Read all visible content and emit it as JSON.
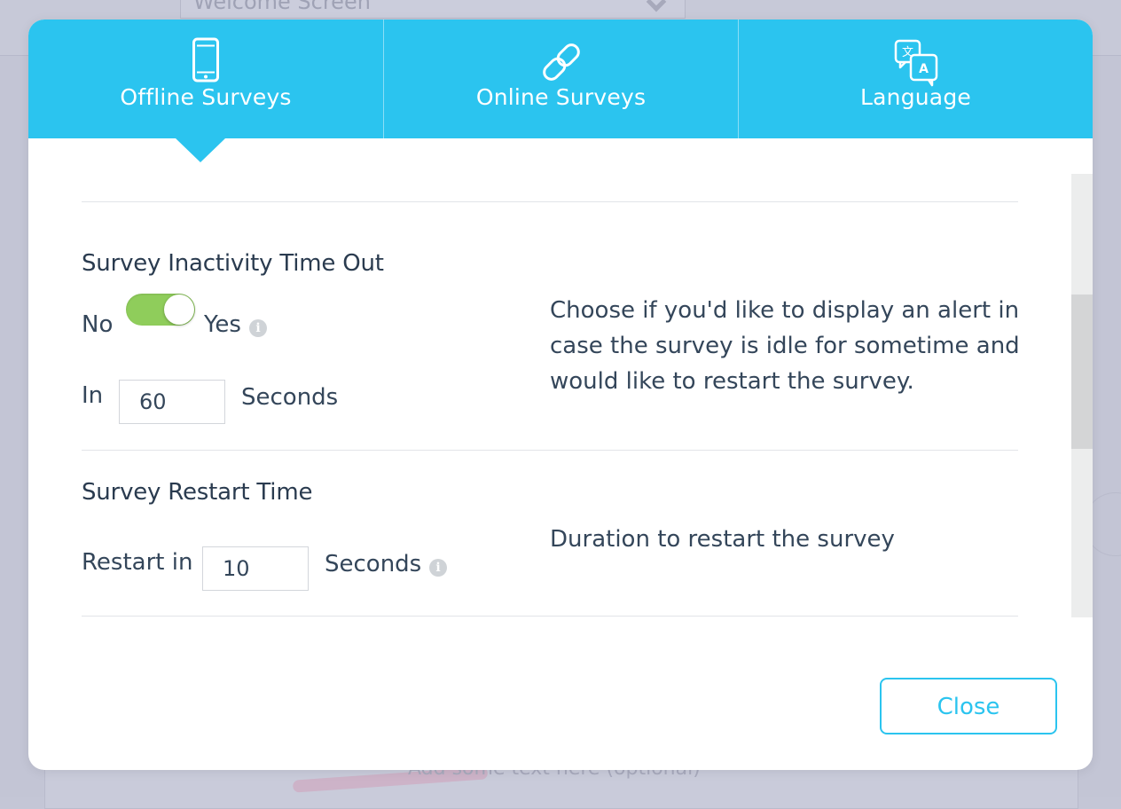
{
  "background": {
    "select_value": "Welcome Screen",
    "footer_placeholder": "Add some text here (optional)"
  },
  "tabs": [
    {
      "label": "Offline Surveys",
      "icon": "phone-icon",
      "active": true
    },
    {
      "label": "Online Surveys",
      "icon": "link-icon",
      "active": false
    },
    {
      "label": "Language",
      "icon": "translate-icon",
      "active": false
    }
  ],
  "inactivity": {
    "title": "Survey Inactivity Time Out",
    "no_label": "No",
    "yes_label": "Yes",
    "toggle_on": true,
    "in_label": "In",
    "seconds_value": "60",
    "seconds_label": "Seconds",
    "description": "Choose if you'd like to display an alert in case the survey is idle for sometime and would like to restart the survey."
  },
  "restart": {
    "title": "Survey Restart Time",
    "restart_label": "Restart in",
    "seconds_value": "10",
    "seconds_label": "Seconds",
    "description": "Duration to restart the survey"
  },
  "footer": {
    "close_label": "Close"
  },
  "colors": {
    "accent": "#2bc4ef",
    "toggle_on": "#8fcd5b",
    "text": "#34465a",
    "overlay": "#c3c5d5"
  }
}
